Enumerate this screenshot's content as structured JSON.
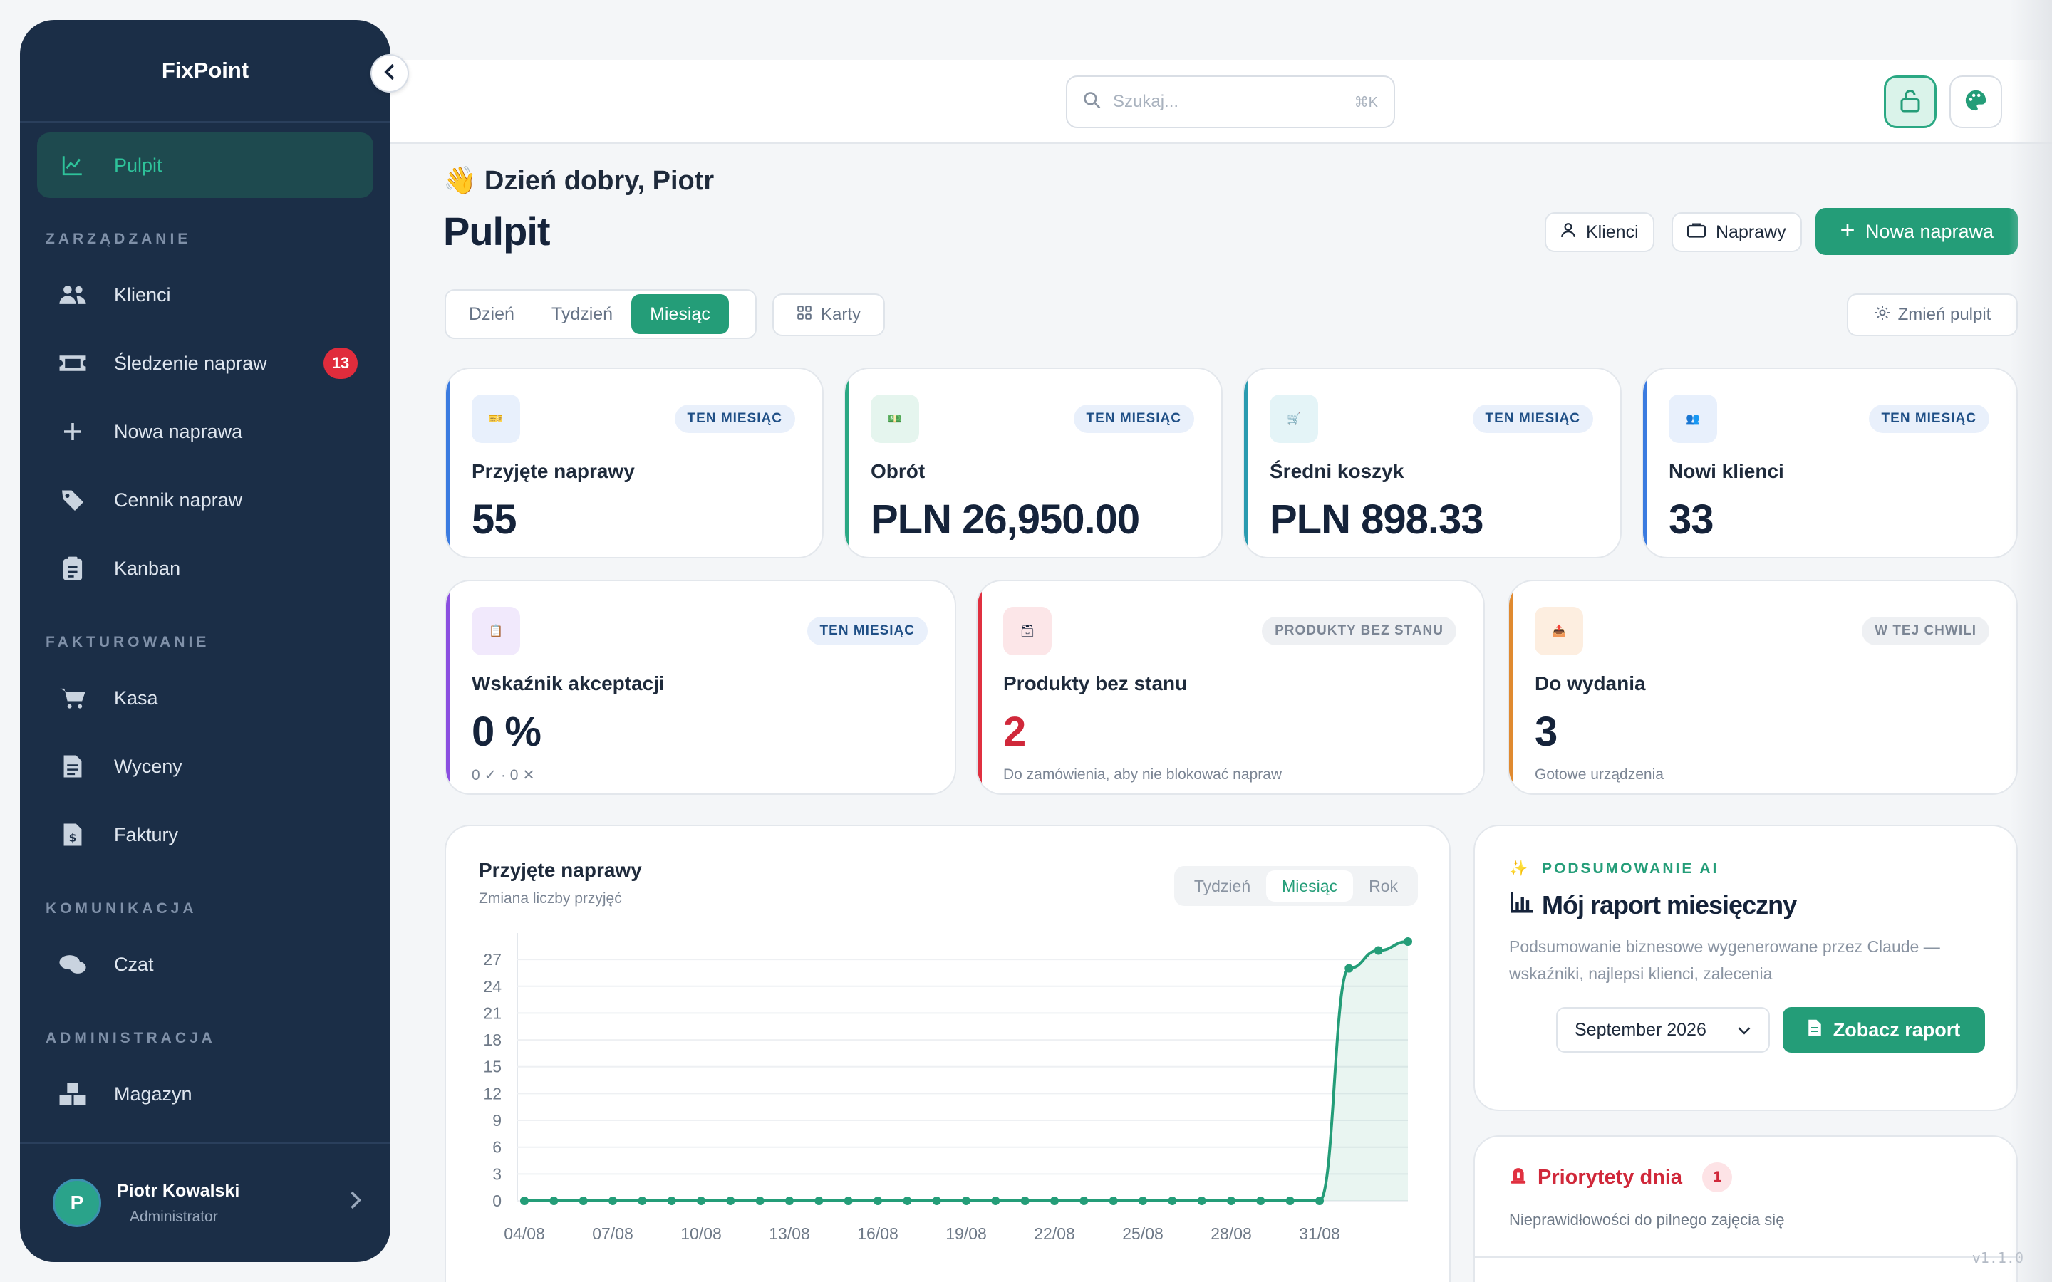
{
  "app": {
    "brand": "FixPoint",
    "version": "v1.1.0"
  },
  "sidebar": {
    "active": {
      "label": "Pulpit",
      "icon": "chart-line-icon"
    },
    "sections": [
      {
        "title": "ZARZĄDZANIE",
        "items": [
          {
            "label": "Klienci",
            "icon": "users-icon"
          },
          {
            "label": "Śledzenie napraw",
            "icon": "ticket-icon",
            "badge": "13"
          },
          {
            "label": "Nowa naprawa",
            "icon": "plus-icon"
          },
          {
            "label": "Cennik napraw",
            "icon": "tags-icon"
          },
          {
            "label": "Kanban",
            "icon": "clipboard-icon"
          }
        ]
      },
      {
        "title": "FAKTUROWANIE",
        "items": [
          {
            "label": "Kasa",
            "icon": "cart-icon"
          },
          {
            "label": "Wyceny",
            "icon": "document-icon"
          },
          {
            "label": "Faktury",
            "icon": "invoice-icon"
          }
        ]
      },
      {
        "title": "KOMUNIKACJA",
        "items": [
          {
            "label": "Czat",
            "icon": "chat-icon"
          }
        ]
      },
      {
        "title": "ADMINISTRACJA",
        "items": [
          {
            "label": "Magazyn",
            "icon": "boxes-icon"
          }
        ]
      }
    ],
    "user": {
      "initial": "P",
      "name": "Piotr Kowalski",
      "role": "Administrator"
    }
  },
  "topbar": {
    "search_placeholder": "Szukaj...",
    "search_shortcut": "⌘K"
  },
  "header": {
    "greeting": "👋 Dzień dobry, Piotr",
    "title": "Pulpit",
    "buttons": {
      "clients": "Klienci",
      "repairs": "Naprawy",
      "new_repair": "Nowa naprawa"
    }
  },
  "filters": {
    "periods": [
      "Dzień",
      "Tydzień",
      "Miesiąc"
    ],
    "active_period": "Miesiąc",
    "cards_label": "Karty",
    "change_dashboard": "Zmień pulpit"
  },
  "stats_row1": [
    {
      "icon": "🎫",
      "tag": "TEN MIESIĄC",
      "label": "Przyjęte naprawy",
      "value": "55",
      "accent": "#3b7be0"
    },
    {
      "icon": "💵",
      "tag": "TEN MIESIĄC",
      "label": "Obrót",
      "value": "PLN 26,950.00",
      "accent": "#2aa883"
    },
    {
      "icon": "🛒",
      "tag": "TEN MIESIĄC",
      "label": "Średni koszyk",
      "value": "PLN 898.33",
      "accent": "#2a9bb0"
    },
    {
      "icon": "👥",
      "tag": "TEN MIESIĄC",
      "label": "Nowi klienci",
      "value": "33",
      "accent": "#3b7be0"
    }
  ],
  "stats_row2": [
    {
      "icon": "📋",
      "tag": "TEN MIESIĄC",
      "label": "Wskaźnik akceptacji",
      "value": "0 %",
      "sub": "0 ✓ · 0 ✕",
      "accent": "#8b4fe0"
    },
    {
      "icon": "🗃",
      "tag": "PRODUKTY BEZ STANU",
      "label": "Produkty bez stanu",
      "value": "2",
      "sub": "Do zamówienia, aby nie blokować napraw",
      "accent": "#e03040"
    },
    {
      "icon": "📤",
      "tag": "W TEJ CHWILI",
      "label": "Do wydania",
      "value": "3",
      "sub": "Gotowe urządzenia",
      "accent": "#e08a30"
    }
  ],
  "chart_panel": {
    "title": "Przyjęte naprawy",
    "subtitle": "Zmiana liczby przyjęć",
    "tabs": [
      "Tydzień",
      "Miesiąc",
      "Rok"
    ],
    "active_tab": "Miesiąc"
  },
  "chart_data": {
    "type": "area",
    "x": [
      "04/08",
      "05/08",
      "06/08",
      "07/08",
      "08/08",
      "09/08",
      "10/08",
      "11/08",
      "12/08",
      "13/08",
      "14/08",
      "15/08",
      "16/08",
      "17/08",
      "18/08",
      "19/08",
      "20/08",
      "21/08",
      "22/08",
      "23/08",
      "24/08",
      "25/08",
      "26/08",
      "27/08",
      "28/08",
      "29/08",
      "30/08",
      "31/08",
      "01/09",
      "02/09",
      "03/09"
    ],
    "x_tick_labels": [
      "04/08",
      "07/08",
      "10/08",
      "13/08",
      "16/08",
      "19/08",
      "22/08",
      "25/08",
      "28/08",
      "31/08"
    ],
    "series": [
      {
        "values": [
          0,
          0,
          0,
          0,
          0,
          0,
          0,
          0,
          0,
          0,
          0,
          0,
          0,
          0,
          0,
          0,
          0,
          0,
          0,
          0,
          0,
          0,
          0,
          0,
          0,
          0,
          0,
          0,
          26,
          28,
          29
        ]
      }
    ],
    "y_ticks": [
      0,
      3,
      6,
      9,
      12,
      15,
      18,
      21,
      24,
      27
    ],
    "ylim": [
      0,
      29
    ],
    "color": "#249d78",
    "grid": true
  },
  "ai_report": {
    "label": "PODSUMOWANIE AI",
    "title": "Mój raport miesięczny",
    "description": "Podsumowanie biznesowe wygenerowane przez Claude — wskaźniki, najlepsi klienci, zalecenia",
    "month": "September 2026",
    "button": "Zobacz raport"
  },
  "priorities": {
    "title": "Priorytety dnia",
    "count": "1",
    "subtitle": "Nieprawidłowości do pilnego zajęcia się"
  }
}
